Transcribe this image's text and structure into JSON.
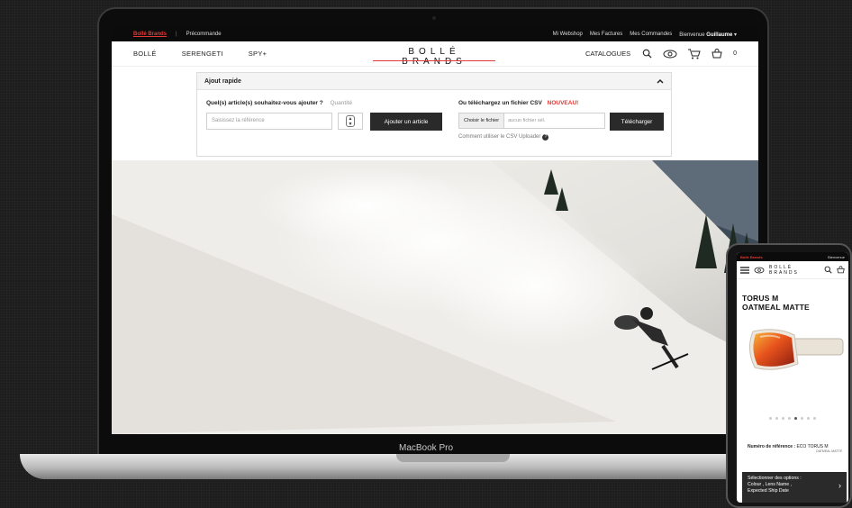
{
  "device": {
    "laptop_model": "MacBook Pro"
  },
  "topbar": {
    "brand": "Bollé Brands",
    "preorder": "Précommande",
    "links": [
      "Mi Webshop",
      "Mes Factures",
      "Mes Commandes"
    ],
    "greeting": "Bienvenue",
    "user": "Guillaume"
  },
  "nav": {
    "brands": [
      "BOLLÉ",
      "SERENGETI",
      "SPY+"
    ],
    "logo": "BOLLÉ BRANDS",
    "catalogues": "CATALOGUES",
    "cart_count": "0",
    "icons": [
      "search-icon",
      "eye-icon",
      "cart-icon",
      "basket-icon"
    ]
  },
  "quick_add": {
    "title": "Ajout rapide",
    "question": "Quel(s) article(s) souhaitez-vous ajouter ?",
    "quantity_label": "Quantité",
    "reference_placeholder": "Saisissez la référence",
    "add_button": "Ajouter un article",
    "csv_label": "Ou téléchargez un fichier CSV",
    "new_badge": "NOUVEAU!",
    "choose_file": "Choisir le fichier",
    "no_file": "aucun fichier sél.",
    "upload_button": "Télécharger",
    "csv_help": "Comment utiliser le CSV Uploader"
  },
  "phone": {
    "brand": "Bollé Brands",
    "greeting": "Bienvenue",
    "logo": "BOLLÉ BRANDS",
    "product_line1": "TORUS M",
    "product_line2": "OATMEAL MATTE",
    "reference_label": "Numéro de référence :",
    "reference_value": "ECO TORUS M",
    "reference_sub": "OATMEAL MATTE",
    "options_title": "Sélectionner des options :",
    "options_line1": "Colour , Lens Name ,",
    "options_line2": "Expected Ship Date",
    "carousel_total": 8,
    "carousel_active": 5
  },
  "colors": {
    "accent": "#e53935",
    "dark": "#2a2a2a"
  }
}
